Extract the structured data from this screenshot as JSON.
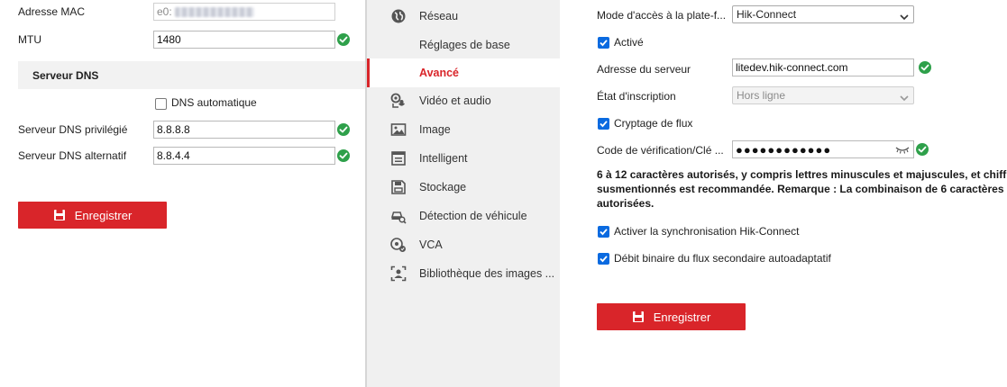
{
  "left": {
    "mac_label": "Adresse MAC",
    "mac_value_prefix": "e0:",
    "mtu_label": "MTU",
    "mtu_value": "1480",
    "dns_section_title": "Serveur DNS",
    "auto_dns_label": "DNS automatique",
    "auto_dns_checked": false,
    "preferred_dns_label": "Serveur DNS privilégié",
    "preferred_dns_value": "8.8.8.8",
    "alternate_dns_label": "Serveur DNS alternatif",
    "alternate_dns_value": "8.8.4.4",
    "save_label": "Enregistrer"
  },
  "sidebar": {
    "items": [
      {
        "label": "Réseau",
        "icon": "globe-icon"
      },
      {
        "label": "Réglages de base",
        "icon": ""
      },
      {
        "label": "Avancé",
        "icon": "",
        "active": true
      },
      {
        "label": "Vidéo et audio",
        "icon": "camera-mic-icon"
      },
      {
        "label": "Image",
        "icon": "image-icon"
      },
      {
        "label": "Intelligent",
        "icon": "list-icon"
      },
      {
        "label": "Stockage",
        "icon": "storage-icon"
      },
      {
        "label": "Détection de véhicule",
        "icon": "vehicle-search-icon"
      },
      {
        "label": "VCA",
        "icon": "vca-icon"
      },
      {
        "label": "Bibliothèque des images ...",
        "icon": "face-library-icon"
      }
    ]
  },
  "right": {
    "access_mode_label": "Mode d'accès à la plate-f...",
    "access_mode_value": "Hik-Connect",
    "enabled_label": "Activé",
    "enabled_checked": true,
    "server_address_label": "Adresse du serveur",
    "server_address_value": "litedev.hik-connect.com",
    "registration_status_label": "État d'inscription",
    "registration_status_value": "Hors ligne",
    "stream_encryption_label": "Cryptage de flux",
    "stream_encryption_checked": true,
    "verification_code_label": "Code de vérification/Clé ...",
    "verification_code_value": "●●●●●●●●●●●●",
    "help_line1": "6 à 12 caractères autorisés, y compris lettres minuscules et majuscules, et chiff",
    "help_line2": "susmentionnés est recommandée. Remarque : La combinaison de 6 caractères",
    "help_line3": "autorisées.",
    "hik_sync_label": "Activer la synchronisation Hik-Connect",
    "hik_sync_checked": true,
    "adaptive_bitrate_label": "Débit binaire du flux secondaire autoadaptatif",
    "adaptive_bitrate_checked": true,
    "save_label": "Enregistrer"
  },
  "colors": {
    "accent_red": "#d9252a",
    "check_blue": "#0a6ae0",
    "ok_green": "#2ea04a",
    "sidebar_bg": "#f0f0f0"
  }
}
